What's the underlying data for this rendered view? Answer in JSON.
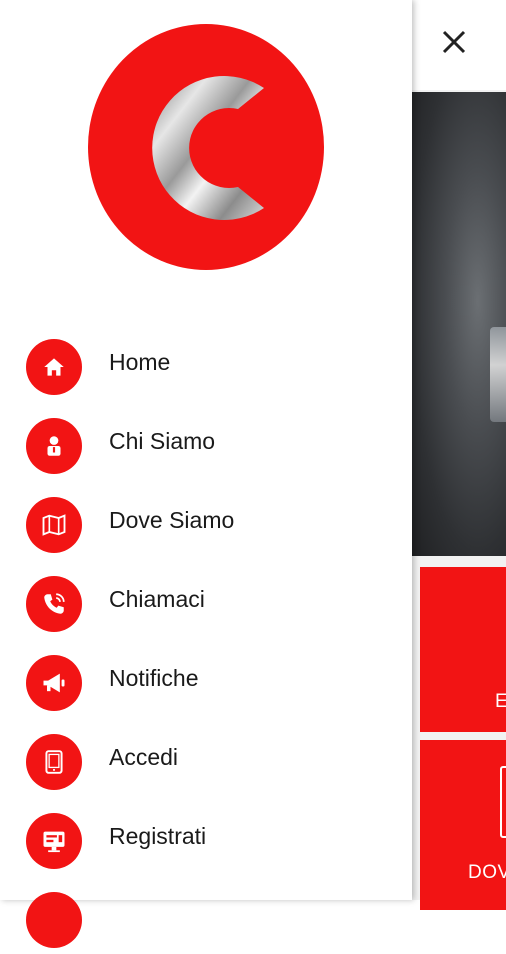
{
  "drawer": {
    "logo_letter": "C",
    "items": [
      {
        "label": "Home",
        "icon": "home-icon"
      },
      {
        "label": "Chi Siamo",
        "icon": "person-icon"
      },
      {
        "label": "Dove Siamo",
        "icon": "map-icon"
      },
      {
        "label": "Chiamaci",
        "icon": "phone-icon"
      },
      {
        "label": "Notifiche",
        "icon": "megaphone-icon"
      },
      {
        "label": "Accedi",
        "icon": "tablet-icon"
      },
      {
        "label": "Registrati",
        "icon": "register-icon"
      }
    ]
  },
  "behind": {
    "close_icon": "close-icon",
    "tiles": [
      {
        "label": "E"
      },
      {
        "label": "DOV"
      }
    ]
  },
  "colors": {
    "accent": "#f21414",
    "text": "#1a1a1a"
  }
}
